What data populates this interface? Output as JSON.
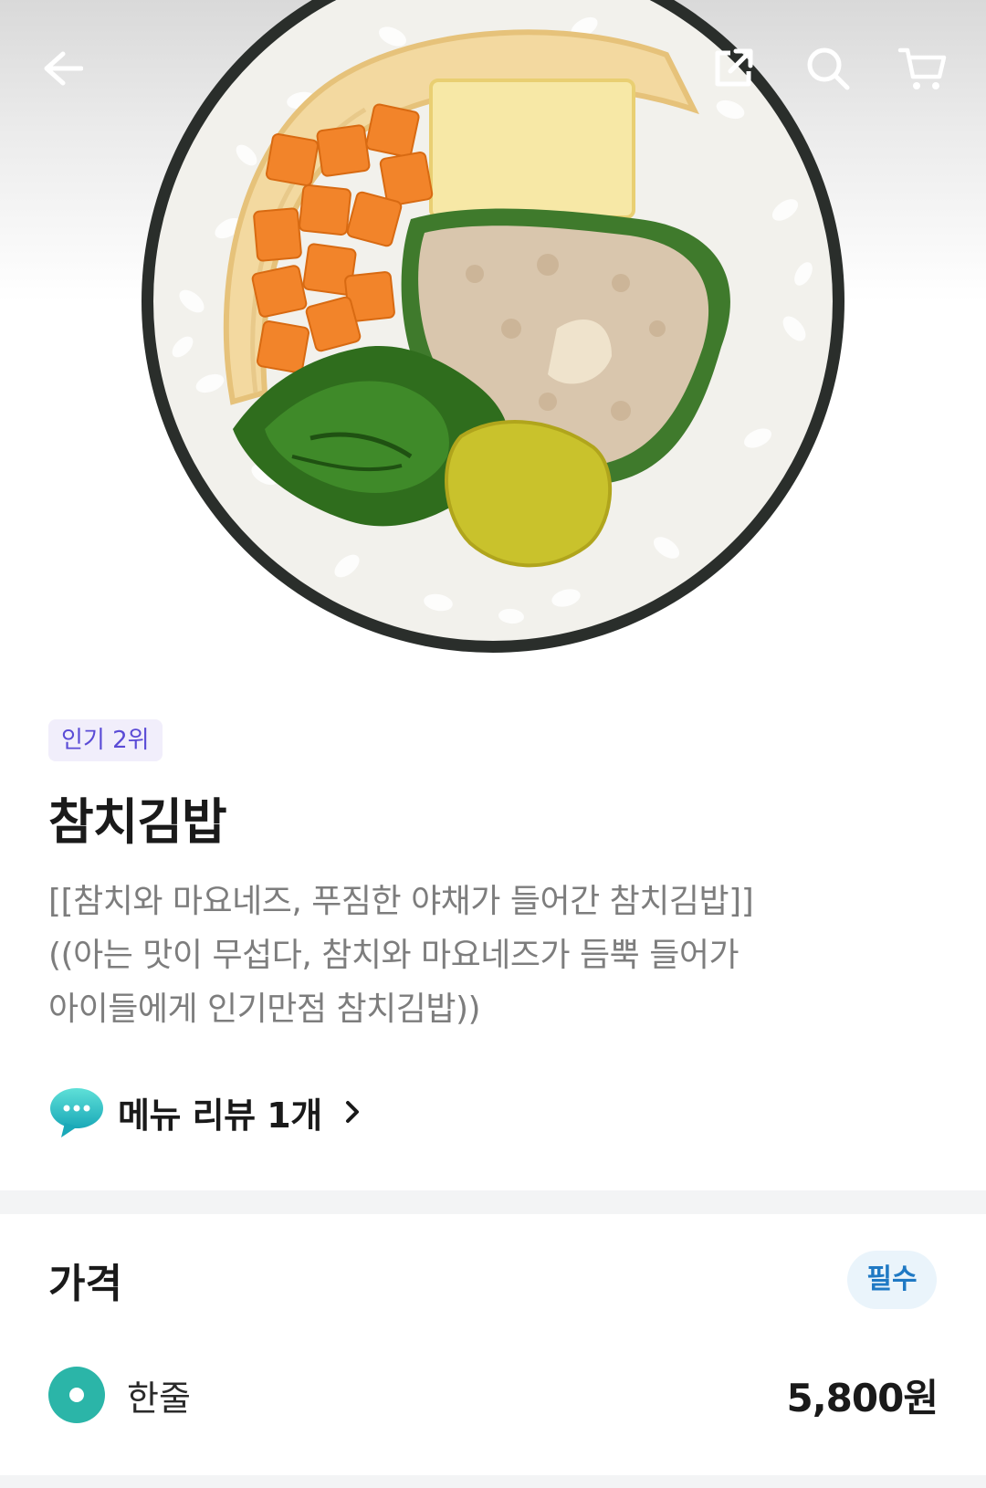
{
  "hero": {
    "image": "tuna-kimbap-cross-section"
  },
  "topbar": {
    "back_icon": "arrow-left-icon",
    "share_icon": "share-icon",
    "search_icon": "search-icon",
    "cart_icon": "cart-icon"
  },
  "product": {
    "rank_badge": "인기 2위",
    "title": "참치김밥",
    "description_lines": [
      "[[참치와 마요네즈, 푸짐한 야채가 들어간 참치김밥]]",
      "((아는 맛이 무섭다, 참치와 마요네즈가 듬뿍 들어가",
      "아이들에게 인기만점 참치김밥))"
    ],
    "review_link": "메뉴 리뷰 1개",
    "review_icon": "speech-bubble-icon"
  },
  "price_section": {
    "title": "가격",
    "required_badge": "필수",
    "options": [
      {
        "label": "한줄",
        "price": "5,800원",
        "selected": true
      }
    ]
  },
  "colors": {
    "accent_teal": "#2bb5a8",
    "rank_badge_text": "#5a4bd6",
    "required_badge_text": "#1f79c4"
  }
}
